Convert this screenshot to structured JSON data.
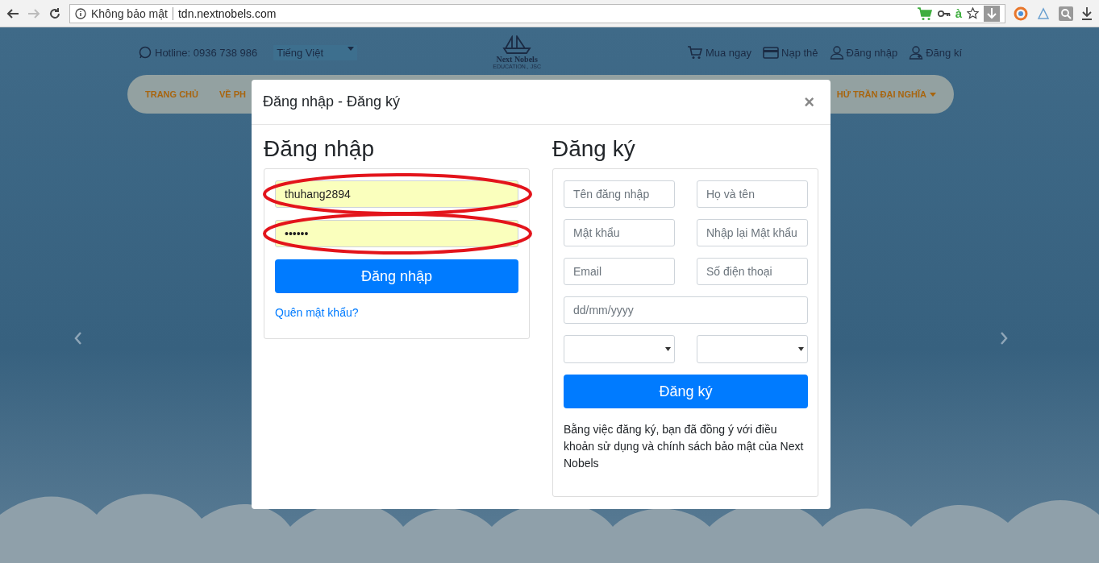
{
  "browser": {
    "back_disabled": false,
    "forward_disabled": true,
    "security": "Không bảo mật",
    "url": "tdn.nextnobels.com",
    "ime_indicator": "à"
  },
  "site_header": {
    "hotline": "Hotline: 0936 738 986",
    "language": "Tiếng Việt",
    "logo_name": "Next Nobels",
    "logo_tagline": "EDUCATION., JSC",
    "links": [
      {
        "kind": "cart",
        "label": "Mua ngay"
      },
      {
        "kind": "card",
        "label": "Nạp thẻ"
      },
      {
        "kind": "user",
        "label": "Đăng nhập"
      },
      {
        "kind": "user-add",
        "label": "Đăng kí"
      }
    ]
  },
  "nav": {
    "left": [
      "TRANG CHỦ",
      "VỀ PH"
    ],
    "right": "HỬ TRẦN ĐẠI NGHĨA"
  },
  "modal": {
    "title": "Đăng nhập - Đăng ký",
    "close": "×",
    "login": {
      "heading": "Đăng nhập",
      "fields": [
        {
          "value": "thuhang2894",
          "autofilled": true,
          "annotated": true
        },
        {
          "value": "••••••",
          "autofilled": true,
          "annotated": true
        }
      ],
      "button": "Đăng nhập",
      "forgot": "Quên mật khẩu?"
    },
    "register": {
      "heading": "Đăng ký",
      "fields": [
        {
          "placeholder": "Tên đăng nhập"
        },
        {
          "placeholder": "Họ và tên"
        },
        {
          "placeholder": "Mật khẩu"
        },
        {
          "placeholder": "Nhập lại Mật khẩu"
        },
        {
          "placeholder": "Email"
        },
        {
          "placeholder": "Số điện thoại"
        }
      ],
      "date_placeholder": "dd/mm/yyyy",
      "button": "Đăng ký",
      "terms": "Bằng việc đăng ký, bạn đã đồng ý với điều khoản sử dụng và chính sách bảo mật của Next Nobels"
    }
  }
}
